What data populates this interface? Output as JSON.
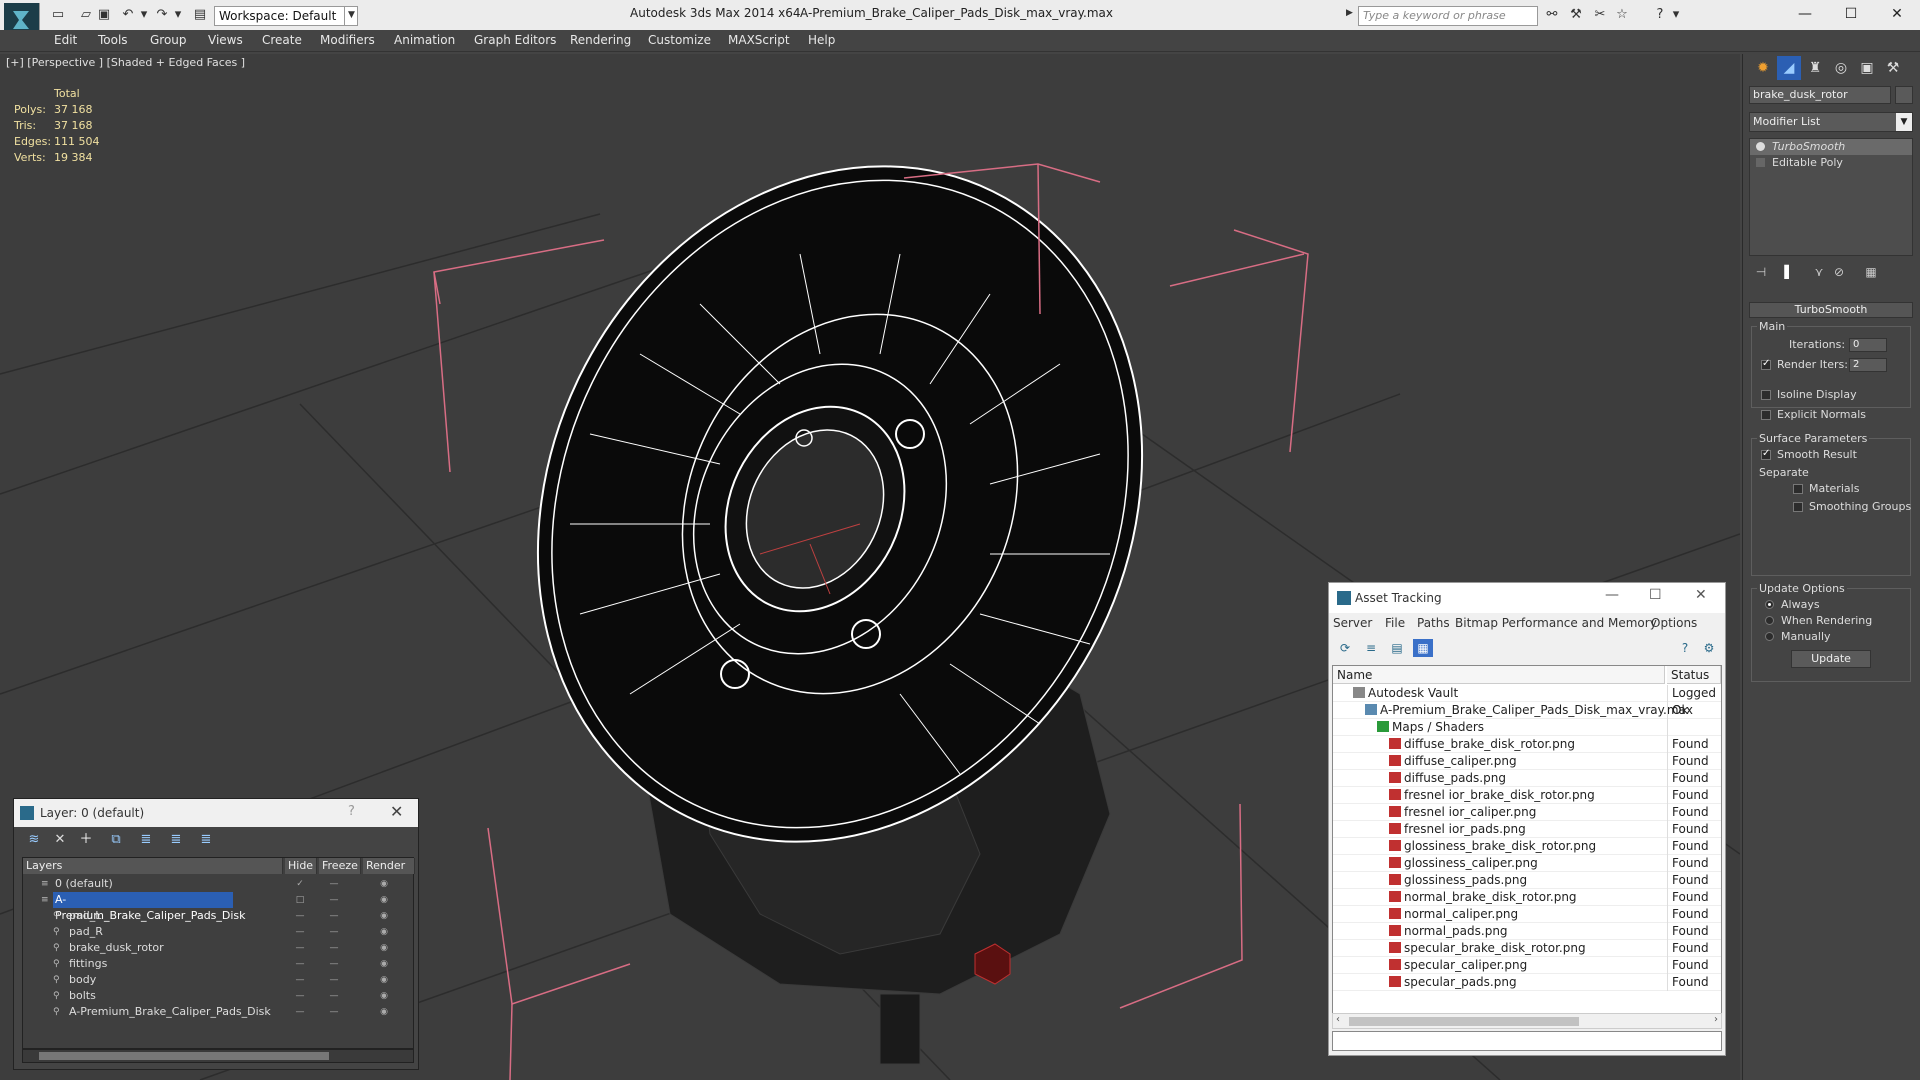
{
  "titlebar": {
    "workspace": "Workspace: Default",
    "app_title": "Autodesk 3ds Max  2014 x64",
    "doc_title": "A-Premium_Brake_Caliper_Pads_Disk_max_vray.max",
    "search_placeholder": "Type a keyword or phrase"
  },
  "menu": [
    "Edit",
    "Tools",
    "Group",
    "Views",
    "Create",
    "Modifiers",
    "Animation",
    "Graph Editors",
    "Rendering",
    "Customize",
    "MAXScript",
    "Help"
  ],
  "viewport": {
    "label": "[+] [Perspective ] [Shaded + Edged Faces ]",
    "stats": {
      "header": "Total",
      "rows": [
        {
          "label": "Polys:",
          "value": "37 168"
        },
        {
          "label": "Tris:",
          "value": "37 168"
        },
        {
          "label": "Edges:",
          "value": "111 504"
        },
        {
          "label": "Verts:",
          "value": "19 384"
        }
      ]
    }
  },
  "command_panel": {
    "object_name": "brake_dusk_rotor",
    "modifier_list": "Modifier List",
    "stack": [
      "TurboSmooth",
      "Editable Poly"
    ],
    "rollout_title": "TurboSmooth",
    "main_group": "Main",
    "iterations_label": "Iterations:",
    "iterations_value": "0",
    "render_iters_label": "Render Iters:",
    "render_iters_value": "2",
    "isoline": "Isoline Display",
    "explicit_normals": "Explicit Normals",
    "surface_params": "Surface Parameters",
    "smooth_result": "Smooth Result",
    "separate": "Separate",
    "materials": "Materials",
    "smoothing_groups": "Smoothing Groups",
    "update_options": "Update Options",
    "always": "Always",
    "when_rendering": "When Rendering",
    "manually": "Manually",
    "update": "Update"
  },
  "layer_dialog": {
    "title": "Layer: 0 (default)",
    "help": "?",
    "columns": [
      "Layers",
      "Hide",
      "Freeze",
      "Render"
    ],
    "rows": [
      {
        "name": "0 (default)",
        "indent": 1
      },
      {
        "name": "A-Premium_Brake_Caliper_Pads_Disk",
        "indent": 1
      },
      {
        "name": "pad_L",
        "indent": 2
      },
      {
        "name": "pad_R",
        "indent": 2
      },
      {
        "name": "brake_dusk_rotor",
        "indent": 2
      },
      {
        "name": "fittings",
        "indent": 2
      },
      {
        "name": "body",
        "indent": 2
      },
      {
        "name": "bolts",
        "indent": 2
      },
      {
        "name": "A-Premium_Brake_Caliper_Pads_Disk",
        "indent": 2
      }
    ]
  },
  "asset_tracking": {
    "title": "Asset Tracking",
    "menu": [
      "Server",
      "File",
      "Paths",
      "Bitmap Performance and Memory",
      "Options"
    ],
    "columns": [
      "Name",
      "Status"
    ],
    "rows": [
      {
        "name": "Autodesk Vault",
        "status": "Logged O",
        "indent": 1
      },
      {
        "name": "A-Premium_Brake_Caliper_Pads_Disk_max_vray.max",
        "status": "Ok",
        "indent": 2
      },
      {
        "name": "Maps / Shaders",
        "status": "",
        "indent": 3
      },
      {
        "name": "diffuse_brake_disk_rotor.png",
        "status": "Found",
        "indent": 4
      },
      {
        "name": "diffuse_caliper.png",
        "status": "Found",
        "indent": 4
      },
      {
        "name": "diffuse_pads.png",
        "status": "Found",
        "indent": 4
      },
      {
        "name": "fresnel ior_brake_disk_rotor.png",
        "status": "Found",
        "indent": 4
      },
      {
        "name": "fresnel ior_caliper.png",
        "status": "Found",
        "indent": 4
      },
      {
        "name": "fresnel ior_pads.png",
        "status": "Found",
        "indent": 4
      },
      {
        "name": "glossiness_brake_disk_rotor.png",
        "status": "Found",
        "indent": 4
      },
      {
        "name": "glossiness_caliper.png",
        "status": "Found",
        "indent": 4
      },
      {
        "name": "glossiness_pads.png",
        "status": "Found",
        "indent": 4
      },
      {
        "name": "normal_brake_disk_rotor.png",
        "status": "Found",
        "indent": 4
      },
      {
        "name": "normal_caliper.png",
        "status": "Found",
        "indent": 4
      },
      {
        "name": "normal_pads.png",
        "status": "Found",
        "indent": 4
      },
      {
        "name": "specular_brake_disk_rotor.png",
        "status": "Found",
        "indent": 4
      },
      {
        "name": "specular_caliper.png",
        "status": "Found",
        "indent": 4
      },
      {
        "name": "specular_pads.png",
        "status": "Found",
        "indent": 4
      }
    ]
  }
}
